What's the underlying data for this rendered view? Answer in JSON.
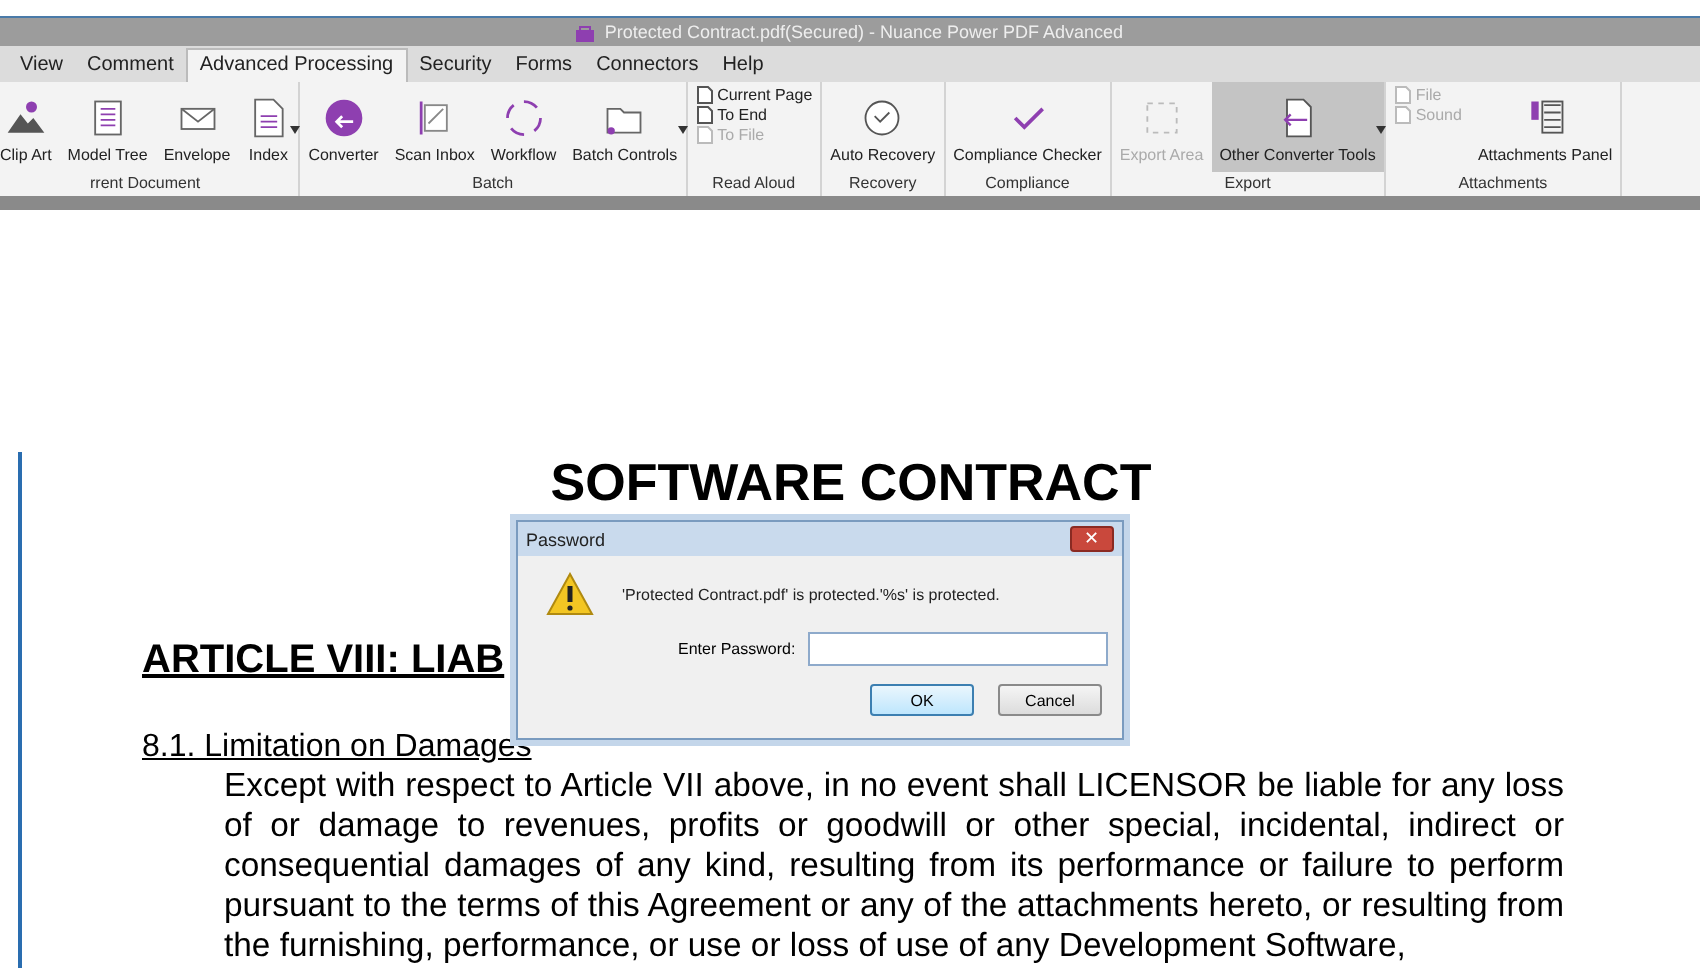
{
  "window": {
    "title": "Protected Contract.pdf(Secured) - Nuance Power PDF Advanced"
  },
  "menu_tabs": [
    {
      "label": "View",
      "selected": false
    },
    {
      "label": "Comment",
      "selected": false
    },
    {
      "label": "Advanced Processing",
      "selected": true
    },
    {
      "label": "Security",
      "selected": false
    },
    {
      "label": "Forms",
      "selected": false
    },
    {
      "label": "Connectors",
      "selected": false
    },
    {
      "label": "Help",
      "selected": false
    }
  ],
  "ribbon_groups": [
    {
      "label": "rrent Document",
      "items": [
        {
          "kind": "large",
          "label": "Clip Art",
          "disabled": false,
          "selected": false,
          "dropdown": false
        },
        {
          "kind": "large",
          "label": "Model Tree",
          "disabled": false,
          "selected": false,
          "dropdown": false
        },
        {
          "kind": "large",
          "label": "Envelope",
          "disabled": false,
          "selected": false,
          "dropdown": false
        },
        {
          "kind": "large",
          "label": "Index",
          "disabled": false,
          "selected": false,
          "dropdown": true
        }
      ]
    },
    {
      "label": "Batch",
      "items": [
        {
          "kind": "large",
          "label": "Converter",
          "disabled": false,
          "selected": false,
          "dropdown": false
        },
        {
          "kind": "large",
          "label": "Scan Inbox",
          "disabled": false,
          "selected": false,
          "dropdown": false
        },
        {
          "kind": "large",
          "label": "Workflow",
          "disabled": false,
          "selected": false,
          "dropdown": false
        },
        {
          "kind": "large",
          "label": "Batch Controls",
          "disabled": false,
          "selected": false,
          "dropdown": true
        }
      ]
    },
    {
      "label": "Read Aloud",
      "items": [
        {
          "kind": "stack",
          "entries": [
            {
              "label": "Current Page",
              "disabled": false
            },
            {
              "label": "To End",
              "disabled": false
            },
            {
              "label": "To File",
              "disabled": true
            }
          ]
        }
      ]
    },
    {
      "label": "Recovery",
      "items": [
        {
          "kind": "large",
          "label": "Auto Recovery",
          "disabled": false,
          "selected": false,
          "dropdown": false
        }
      ]
    },
    {
      "label": "Compliance",
      "items": [
        {
          "kind": "large",
          "label": "Compliance Checker",
          "disabled": false,
          "selected": false,
          "dropdown": false
        }
      ]
    },
    {
      "label": "Export",
      "items": [
        {
          "kind": "large",
          "label": "Export Area",
          "disabled": true,
          "selected": false,
          "dropdown": false
        },
        {
          "kind": "large",
          "label": "Other Converter Tools",
          "disabled": false,
          "selected": true,
          "dropdown": true
        }
      ]
    },
    {
      "label": "Attachments",
      "items": [
        {
          "kind": "stack",
          "entries": [
            {
              "label": "File",
              "disabled": true
            },
            {
              "label": "Sound",
              "disabled": true
            }
          ]
        },
        {
          "kind": "large",
          "label": "Attachments Panel",
          "disabled": false,
          "selected": false,
          "dropdown": false
        }
      ]
    }
  ],
  "document": {
    "title": "SOFTWARE CONTRACT",
    "article_heading": "ARTICLE VIII: LIAB",
    "section_heading": "8.1. Limitation on Damages",
    "paragraph": "Except with respect to Article VII above, in no event shall LICENSOR be liable for any loss of or damage to revenues, profits or goodwill or other special, incidental, indirect or consequential damages of any kind, resulting from its performance or failure to perform pursuant to the terms of this Agreement or any of the attachments hereto, or resulting from the furnishing, performance, or use or loss of use of any Development Software,"
  },
  "dialog": {
    "title": "Password",
    "close_glyph": "✕",
    "message": "'Protected Contract.pdf' is protected.'%s' is protected.",
    "field_label": "Enter Password:",
    "buttons": [
      {
        "label": "OK",
        "selected": true
      },
      {
        "label": "Cancel",
        "selected": false
      }
    ]
  }
}
